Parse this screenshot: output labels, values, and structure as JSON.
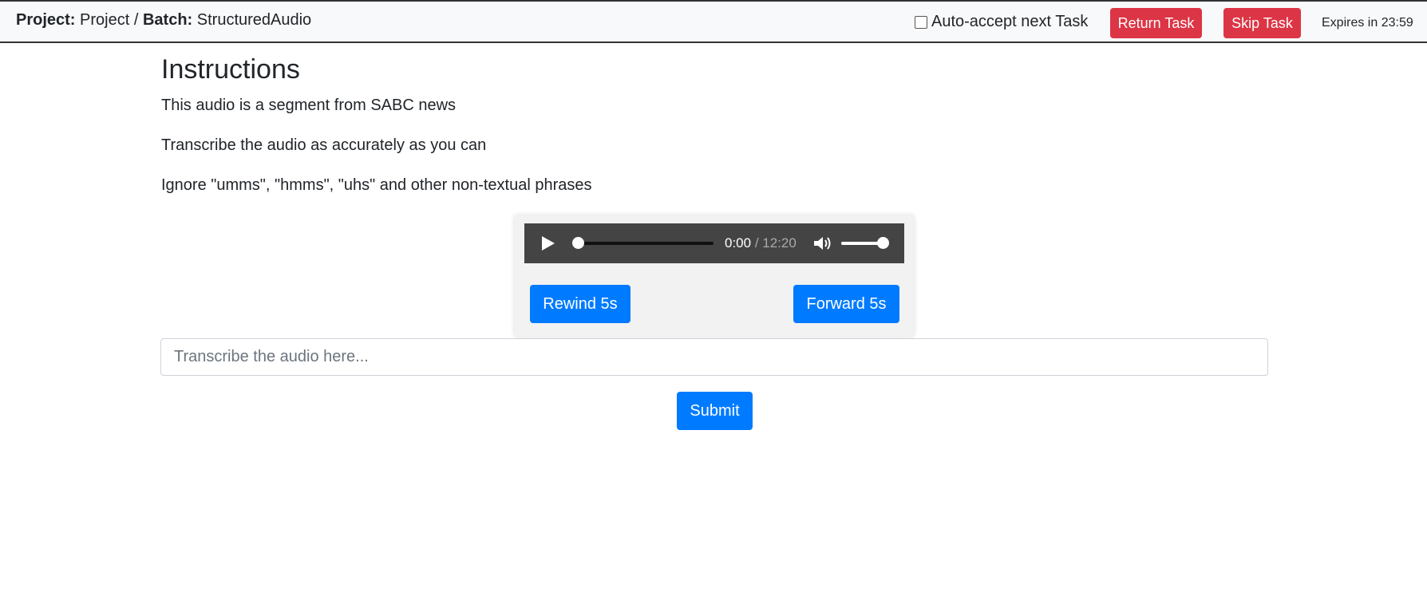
{
  "header": {
    "project_label": "Project:",
    "project_name": "Project",
    "separator": "/",
    "batch_label": "Batch:",
    "batch_name": "StructuredAudio",
    "auto_accept_label": "Auto-accept next Task",
    "auto_accept_checked": false,
    "return_label": "Return Task",
    "skip_label": "Skip Task",
    "expires_text": "Expires in 23:59",
    "button_color": "#dc3545"
  },
  "instructions": {
    "title": "Instructions",
    "paragraphs": [
      "This audio is a segment from SABC news",
      "Transcribe the audio as accurately as you can",
      "Ignore \"umms\", \"hmms\", \"uhs\" and other non-textual phrases"
    ]
  },
  "player": {
    "current_time": "0:00",
    "duration": "/ 12:20",
    "progress_fraction": 0,
    "volume_fraction": 1,
    "rewind_label": "Rewind 5s",
    "forward_label": "Forward 5s",
    "button_color": "#007bff"
  },
  "form": {
    "input_value": "",
    "input_placeholder": "Transcribe the audio here...",
    "submit_label": "Submit"
  }
}
